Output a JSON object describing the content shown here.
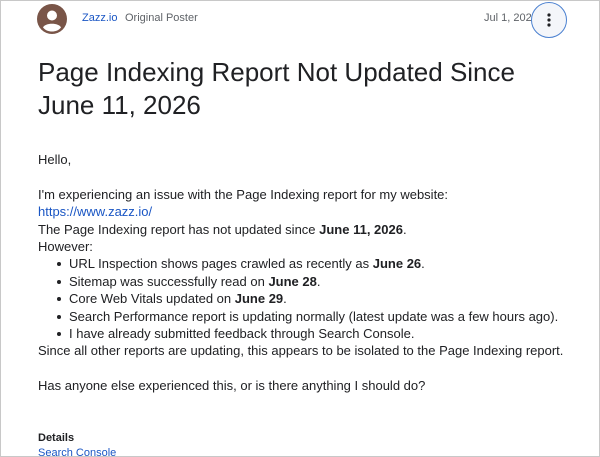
{
  "post": {
    "author": "Zazz.io",
    "role": "Original Poster",
    "date": "Jul 1, 2026",
    "title": "Page Indexing Report Not Updated Since June 11, 2026",
    "greeting": "Hello,",
    "intro": "I'm experiencing an issue with the Page Indexing report for my website:",
    "site_url": "https://www.zazz.io/",
    "not_updated_prefix": "The Page Indexing report has not updated since ",
    "not_updated_date": "June 11, 2026",
    "not_updated_suffix": ".",
    "however": "However:",
    "items": [
      {
        "text": "URL Inspection shows pages crawled as recently as ",
        "bold": "June 26",
        "after": "."
      },
      {
        "text": "Sitemap was successfully read on ",
        "bold": "June 28",
        "after": "."
      },
      {
        "text": "Core Web Vitals updated on ",
        "bold": "June 29",
        "after": "."
      },
      {
        "text": "Search Performance report is updating normally (latest update was a few hours ago).",
        "bold": "",
        "after": ""
      },
      {
        "text": "I have already submitted feedback through Search Console.",
        "bold": "",
        "after": ""
      }
    ],
    "conclusion": "Since all other reports are updating, this appears to be isolated to the Page Indexing report.",
    "question": "Has anyone else experienced this, or is there anything I should do?"
  },
  "details": {
    "label": "Details",
    "category": "Search Console"
  },
  "icons": {
    "avatar": "user-avatar-icon",
    "more": "more-vert-icon"
  },
  "colors": {
    "avatar": "#795548",
    "link": "#1a56c4",
    "text": "#202124",
    "muted": "#5f6368"
  }
}
